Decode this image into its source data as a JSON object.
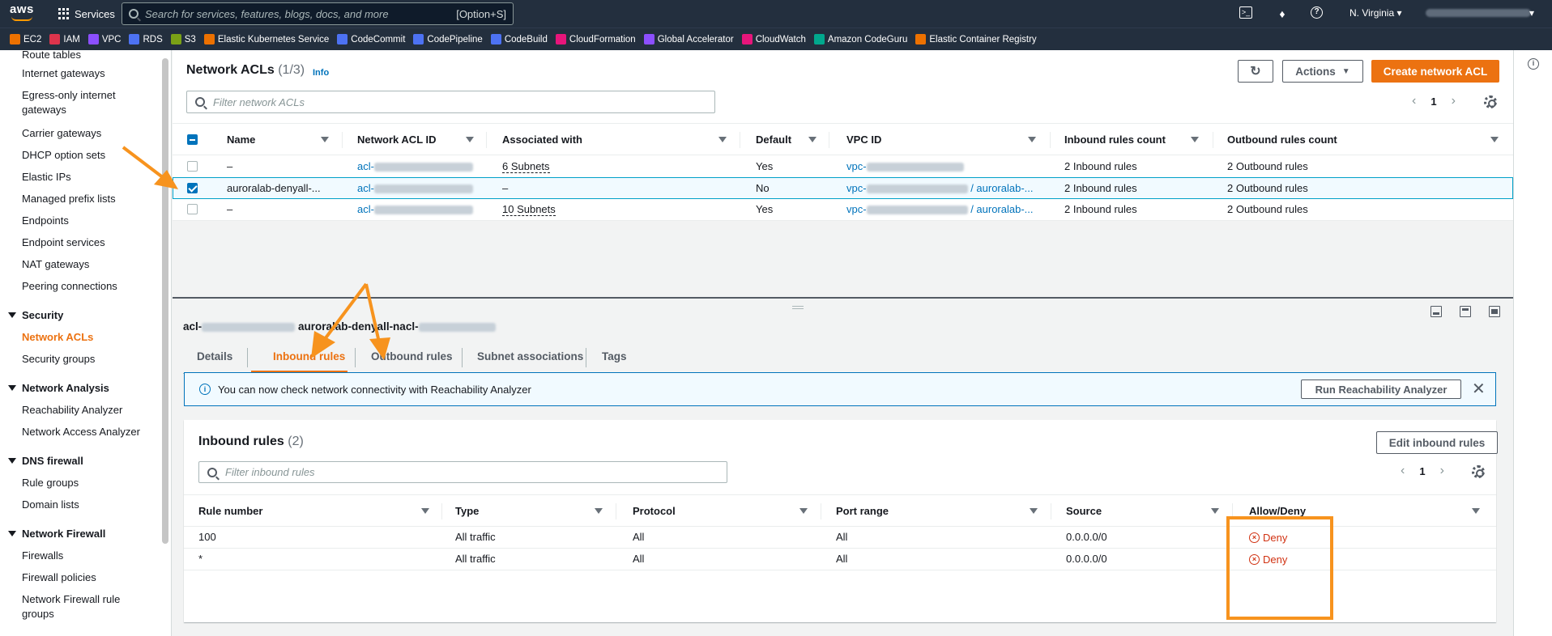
{
  "topnav": {
    "logo": "aws",
    "services_label": "Services",
    "search_placeholder": "Search for services, features, blogs, docs, and more",
    "search_shortcut": "[Option+S]",
    "region": "N. Virginia"
  },
  "favorites": [
    {
      "label": "EC2",
      "color": "#ed7100"
    },
    {
      "label": "IAM",
      "color": "#dd344c"
    },
    {
      "label": "VPC",
      "color": "#8c4fff"
    },
    {
      "label": "RDS",
      "color": "#4d72f3"
    },
    {
      "label": "S3",
      "color": "#7aa116"
    },
    {
      "label": "Elastic Kubernetes Service",
      "color": "#ed7100"
    },
    {
      "label": "CodeCommit",
      "color": "#4d72f3"
    },
    {
      "label": "CodePipeline",
      "color": "#4d72f3"
    },
    {
      "label": "CodeBuild",
      "color": "#4d72f3"
    },
    {
      "label": "CloudFormation",
      "color": "#e7157b"
    },
    {
      "label": "Global Accelerator",
      "color": "#8c4fff"
    },
    {
      "label": "CloudWatch",
      "color": "#e7157b"
    },
    {
      "label": "Amazon CodeGuru",
      "color": "#01a88d"
    },
    {
      "label": "Elastic Container Registry",
      "color": "#ed7100"
    }
  ],
  "sidebar": {
    "items_top": [
      "Route tables",
      "Internet gateways",
      "Egress-only internet gateways",
      "Carrier gateways",
      "DHCP option sets",
      "Elastic IPs",
      "Managed prefix lists",
      "Endpoints",
      "Endpoint services",
      "NAT gateways",
      "Peering connections"
    ],
    "security": {
      "title": "Security",
      "items": [
        "Network ACLs",
        "Security groups"
      ]
    },
    "network_analysis": {
      "title": "Network Analysis",
      "items": [
        "Reachability Analyzer",
        "Network Access Analyzer"
      ]
    },
    "dns_firewall": {
      "title": "DNS firewall",
      "items": [
        "Rule groups",
        "Domain lists"
      ]
    },
    "network_firewall": {
      "title": "Network Firewall",
      "items": [
        "Firewalls",
        "Firewall policies",
        "Network Firewall rule groups"
      ]
    }
  },
  "acl_panel": {
    "title": "Network ACLs",
    "count": "(1/3)",
    "info": "Info",
    "actions_label": "Actions",
    "create_label": "Create network ACL",
    "filter_placeholder": "Filter network ACLs",
    "page": "1",
    "columns": [
      "Name",
      "Network ACL ID",
      "Associated with",
      "Default",
      "VPC ID",
      "Inbound rules count",
      "Outbound rules count"
    ],
    "rows": [
      {
        "name": "–",
        "acl_id": "acl-",
        "associated": "6 Subnets",
        "default": "Yes",
        "vpc": "vpc-",
        "vpc_suffix": "",
        "inbound": "2 Inbound rules",
        "outbound": "2 Outbound rules",
        "selected": false
      },
      {
        "name": "auroralab-denyall-...",
        "acl_id": "acl-",
        "associated": "–",
        "default": "No",
        "vpc": "vpc-",
        "vpc_suffix": "/ auroralab-...",
        "inbound": "2 Inbound rules",
        "outbound": "2 Outbound rules",
        "selected": true
      },
      {
        "name": "–",
        "acl_id": "acl-",
        "associated": "10 Subnets",
        "default": "Yes",
        "vpc": "vpc-",
        "vpc_suffix": "/ auroralab-...",
        "inbound": "2 Inbound rules",
        "outbound": "2 Outbound rules",
        "selected": false
      }
    ]
  },
  "details": {
    "title_prefix": "acl-",
    "title_suffix": "auroralab-denyall-nacl-",
    "tabs": [
      "Details",
      "Inbound rules",
      "Outbound rules",
      "Subnet associations",
      "Tags"
    ],
    "active_tab": "Inbound rules",
    "flash_text": "You can now check network connectivity with Reachability Analyzer",
    "flash_button": "Run Reachability Analyzer"
  },
  "inbound": {
    "title": "Inbound rules",
    "count": "(2)",
    "edit_label": "Edit inbound rules",
    "filter_placeholder": "Filter inbound rules",
    "page": "1",
    "columns": [
      "Rule number",
      "Type",
      "Protocol",
      "Port range",
      "Source",
      "Allow/Deny"
    ],
    "rows": [
      {
        "rule": "100",
        "type": "All traffic",
        "protocol": "All",
        "port": "All",
        "source": "0.0.0.0/0",
        "action": "Deny"
      },
      {
        "rule": "*",
        "type": "All traffic",
        "protocol": "All",
        "port": "All",
        "source": "0.0.0.0/0",
        "action": "Deny"
      }
    ]
  },
  "colors": {
    "accent": "#ec7211",
    "link": "#0073bb",
    "deny": "#d13212",
    "annotation": "#f7931e"
  }
}
